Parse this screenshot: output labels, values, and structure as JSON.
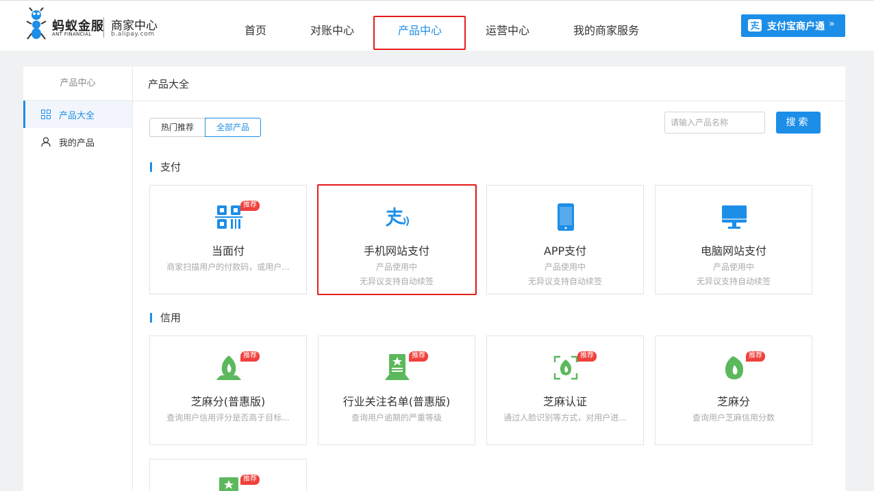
{
  "header": {
    "logo_cn": "蚂蚁金服",
    "logo_en": "ANT FINANCIAL",
    "logo_sub_cn": "商家中心",
    "logo_sub_en": "b.alipay.com",
    "nav": [
      "首页",
      "对账中心",
      "产品中心",
      "运营中心",
      "我的商家服务"
    ],
    "active_nav": "产品中心",
    "merchant_button": "支付宝商户通",
    "merchant_chevron": "»"
  },
  "sidebar": {
    "title": "产品中心",
    "items": [
      {
        "label": "产品大全",
        "icon": "grid-icon",
        "active": true
      },
      {
        "label": "我的产品",
        "icon": "user-icon",
        "active": false
      }
    ]
  },
  "content": {
    "title": "产品大全",
    "tabs": [
      {
        "label": "热门推荐",
        "active": false
      },
      {
        "label": "全部产品",
        "active": true
      }
    ],
    "search": {
      "placeholder": "请输入产品名称",
      "button": "搜索"
    }
  },
  "sections": [
    {
      "title": "支付",
      "cards": [
        {
          "name": "当面付",
          "desc": [
            "商家扫描用户的付款码，或用户..."
          ],
          "badge": "推荐",
          "icon": "qrcode-icon"
        },
        {
          "name": "手机网站支付",
          "desc": [
            "产品使用中",
            "无异议支持自动续签"
          ],
          "badge": "",
          "icon": "alipay-logo-icon"
        },
        {
          "name": "APP支付",
          "desc": [
            "产品使用中",
            "无异议支持自动续签"
          ],
          "badge": "",
          "icon": "phone-icon"
        },
        {
          "name": "电脑网站支付",
          "desc": [
            "产品使用中",
            "无异议支持自动续签"
          ],
          "badge": "",
          "icon": "monitor-icon"
        }
      ]
    },
    {
      "title": "信用",
      "cards": [
        {
          "name": "芝麻分(普惠版)",
          "desc": [
            "查询用户信用评分是否高于目标..."
          ],
          "badge": "推荐",
          "icon": "sesame-icon"
        },
        {
          "name": "行业关注名单(普惠版)",
          "desc": [
            "查询用户逾期的严重等级"
          ],
          "badge": "推荐",
          "icon": "certificate-icon"
        },
        {
          "name": "芝麻认证",
          "desc": [
            "通过人脸识别等方式，对用户进..."
          ],
          "badge": "推荐",
          "icon": "face-scan-icon"
        },
        {
          "name": "芝麻分",
          "desc": [
            "查询用户芝麻信用分数"
          ],
          "badge": "推荐",
          "icon": "sesame-drop-icon"
        },
        {
          "name": "",
          "desc": [],
          "badge": "推荐",
          "icon": "certificate-icon"
        }
      ]
    }
  ],
  "colors": {
    "accent": "#1c8ee8",
    "highlight": "#e41c1c",
    "badge": "#f0413c",
    "credit_green": "#5cb85c"
  }
}
